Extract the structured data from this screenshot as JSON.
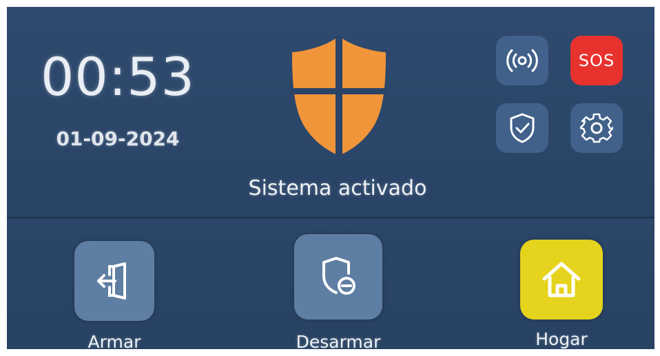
{
  "clock": {
    "time": "00:53",
    "date": "01-09-2024"
  },
  "status": {
    "text": "Sistema activado"
  },
  "quick_actions": {
    "alarm_icon": "broadcast-icon",
    "sos_label": "SOS",
    "protect_icon": "shield-check-icon",
    "settings_icon": "gear-icon"
  },
  "modes": [
    {
      "label": "Armar",
      "icon": "door-enter-icon"
    },
    {
      "label": "Desarmar",
      "icon": "shield-minus-icon"
    },
    {
      "label": "Hogar",
      "icon": "house-icon"
    }
  ],
  "colors": {
    "background": "#2a4467",
    "shield": "#f0953a",
    "sos": "#e8322e",
    "home": "#e5d31d",
    "button": "#5f7ea3"
  }
}
